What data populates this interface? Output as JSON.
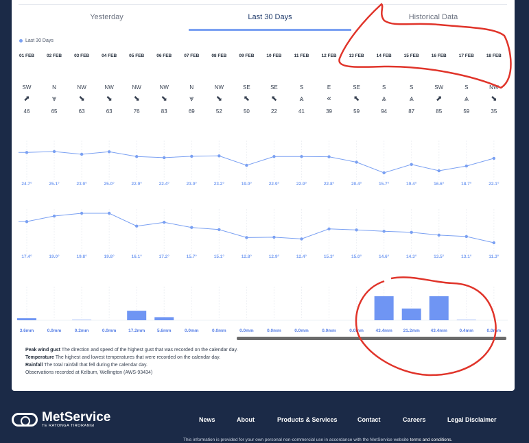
{
  "tabs": [
    {
      "label": "Yesterday"
    },
    {
      "label": "Last 30 Days"
    },
    {
      "label": "Historical Data"
    }
  ],
  "legend": "Last 30 Days",
  "days": [
    {
      "date": "01 FEB",
      "dir": "SW",
      "arrow": "⬈",
      "gust": "46",
      "max": 24.7,
      "max_label": "24.7°",
      "min": 17.4,
      "min_label": "17.4°",
      "rain": 3.6,
      "rain_label": "3.6mm"
    },
    {
      "date": "02 FEB",
      "dir": "N",
      "arrow": "⩔",
      "gust": "65",
      "max": 25.1,
      "max_label": "25.1°",
      "min": 19.0,
      "min_label": "19.0°",
      "rain": 0.0,
      "rain_label": "0.0mm"
    },
    {
      "date": "03 FEB",
      "dir": "NW",
      "arrow": "⬊",
      "gust": "63",
      "max": 23.9,
      "max_label": "23.9°",
      "min": 19.8,
      "min_label": "19.8°",
      "rain": 0.2,
      "rain_label": "0.2mm"
    },
    {
      "date": "04 FEB",
      "dir": "NW",
      "arrow": "⬊",
      "gust": "63",
      "max": 25.0,
      "max_label": "25.0°",
      "min": 19.8,
      "min_label": "19.8°",
      "rain": 0.0,
      "rain_label": "0.0mm"
    },
    {
      "date": "05 FEB",
      "dir": "NW",
      "arrow": "⬊",
      "gust": "76",
      "max": 22.9,
      "max_label": "22.9°",
      "min": 16.1,
      "min_label": "16.1°",
      "rain": 17.2,
      "rain_label": "17.2mm"
    },
    {
      "date": "06 FEB",
      "dir": "NW",
      "arrow": "⬊",
      "gust": "83",
      "max": 22.4,
      "max_label": "22.4°",
      "min": 17.2,
      "min_label": "17.2°",
      "rain": 5.6,
      "rain_label": "5.6mm"
    },
    {
      "date": "07 FEB",
      "dir": "N",
      "arrow": "⩔",
      "gust": "69",
      "max": 23.0,
      "max_label": "23.0°",
      "min": 15.7,
      "min_label": "15.7°",
      "rain": 0.0,
      "rain_label": "0.0mm"
    },
    {
      "date": "08 FEB",
      "dir": "NW",
      "arrow": "⬊",
      "gust": "52",
      "max": 23.2,
      "max_label": "23.2°",
      "min": 15.1,
      "min_label": "15.1°",
      "rain": 0.0,
      "rain_label": "0.0mm"
    },
    {
      "date": "09 FEB",
      "dir": "SE",
      "arrow": "⬉",
      "gust": "50",
      "max": 19.0,
      "max_label": "19.0°",
      "min": 12.8,
      "min_label": "12.8°",
      "rain": 0.0,
      "rain_label": "0.0mm"
    },
    {
      "date": "10 FEB",
      "dir": "SE",
      "arrow": "⬉",
      "gust": "22",
      "max": 22.9,
      "max_label": "22.9°",
      "min": 12.9,
      "min_label": "12.9°",
      "rain": 0.0,
      "rain_label": "0.0mm"
    },
    {
      "date": "11 FEB",
      "dir": "S",
      "arrow": "⩓",
      "gust": "41",
      "max": 22.9,
      "max_label": "22.9°",
      "min": 12.4,
      "min_label": "12.4°",
      "rain": 0.0,
      "rain_label": "0.0mm"
    },
    {
      "date": "12 FEB",
      "dir": "E",
      "arrow": "«",
      "gust": "39",
      "max": 22.8,
      "max_label": "22.8°",
      "min": 15.3,
      "min_label": "15.3°",
      "rain": 0.0,
      "rain_label": "0.0mm"
    },
    {
      "date": "13 FEB",
      "dir": "SE",
      "arrow": "⬉",
      "gust": "59",
      "max": 20.4,
      "max_label": "20.4°",
      "min": 15.0,
      "min_label": "15.0°",
      "rain": 0.0,
      "rain_label": "0.0mm"
    },
    {
      "date": "14 FEB",
      "dir": "S",
      "arrow": "⩓",
      "gust": "94",
      "max": 15.7,
      "max_label": "15.7°",
      "min": 14.6,
      "min_label": "14.6°",
      "rain": 43.4,
      "rain_label": "43.4mm"
    },
    {
      "date": "15 FEB",
      "dir": "S",
      "arrow": "⩓",
      "gust": "87",
      "max": 19.4,
      "max_label": "19.4°",
      "min": 14.3,
      "min_label": "14.3°",
      "rain": 21.2,
      "rain_label": "21.2mm"
    },
    {
      "date": "16 FEB",
      "dir": "SW",
      "arrow": "⬈",
      "gust": "85",
      "max": 16.6,
      "max_label": "16.6°",
      "min": 13.5,
      "min_label": "13.5°",
      "rain": 43.4,
      "rain_label": "43.4mm"
    },
    {
      "date": "17 FEB",
      "dir": "S",
      "arrow": "⩓",
      "gust": "59",
      "max": 18.7,
      "max_label": "18.7°",
      "min": 13.1,
      "min_label": "13.1°",
      "rain": 0.4,
      "rain_label": "0.4mm"
    },
    {
      "date": "18 FEB",
      "dir": "NW",
      "arrow": "⬊",
      "gust": "35",
      "max": 22.1,
      "max_label": "22.1°",
      "min": 11.3,
      "min_label": "11.3°",
      "rain": 0.0,
      "rain_label": "0.0mm"
    }
  ],
  "notes": {
    "gust_title": "Peak wind gust",
    "gust_text": " The direction and speed of the highest gust that was recorded on the calendar day.",
    "temp_title": "Temperature",
    "temp_text": " The highest and lowest temperatures that were recorded on the calendar day.",
    "rain_title": "Rainfall",
    "rain_text": " The total rainfall that fell during the calendar day.",
    "station": "Observations recorded at Kelburn, Wellington (AWS-93434)"
  },
  "footer": {
    "logo": "MetService",
    "logo_sub": "TE RATONGA TIRORANGI",
    "links": [
      "News",
      "About",
      "Products & Services",
      "Contact",
      "Careers",
      "Legal Disclaimer"
    ],
    "disclaimer": "This information is provided for your own personal non-commercial use in accordance with the MetService website ",
    "disclaimer_link": "terms and conditions."
  },
  "colors": {
    "accent": "#7aa0f2",
    "rain_bar": "#6f95f3",
    "annotation": "#e0342a",
    "footer_bg": "#1b2a47"
  }
}
